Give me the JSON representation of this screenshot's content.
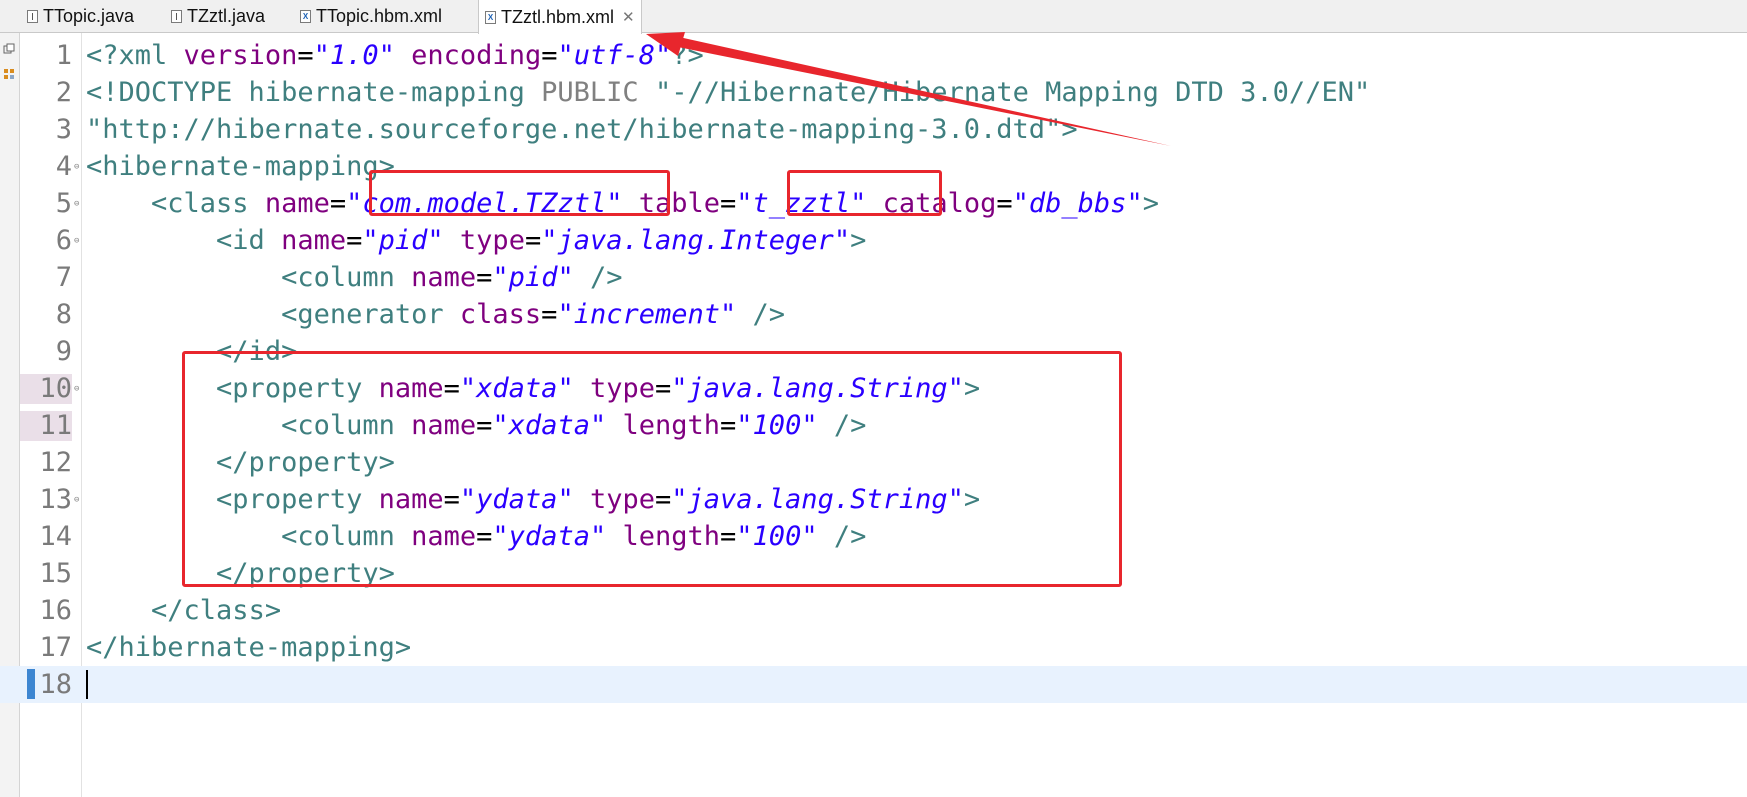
{
  "editor": {
    "tabs": [
      {
        "label": "TTopic.java",
        "icon": "java-file-icon",
        "active": false
      },
      {
        "label": "TZztl.java",
        "icon": "java-file-icon",
        "active": false
      },
      {
        "label": "TTopic.hbm.xml",
        "icon": "xml-file-icon",
        "active": false
      },
      {
        "label": "TZztl.hbm.xml",
        "icon": "xml-file-icon",
        "active": true,
        "close": "✕"
      }
    ],
    "xml_icon_glyph": "X",
    "selected_lines": [
      10,
      11
    ],
    "current_line": 18,
    "lines": [
      {
        "num": "1",
        "fold": false,
        "tokens": [
          [
            "tag",
            "<?xml "
          ],
          [
            "attr",
            "version"
          ],
          [
            "txt",
            "="
          ],
          [
            "str",
            "\"1.0\""
          ],
          [
            "txt",
            " "
          ],
          [
            "attr",
            "encoding"
          ],
          [
            "txt",
            "="
          ],
          [
            "str",
            "\"utf-8\""
          ],
          [
            "tag",
            "?>"
          ]
        ]
      },
      {
        "num": "2",
        "fold": false,
        "tokens": [
          [
            "tag",
            "<!DOCTYPE hibernate-mapping "
          ],
          [
            "kw",
            "PUBLIC"
          ],
          [
            "txt",
            " "
          ],
          [
            "doc",
            "\"-//Hibernate/Hibernate Mapping DTD 3.0//EN\""
          ]
        ]
      },
      {
        "num": "3",
        "fold": false,
        "tokens": [
          [
            "doc",
            "\"http://hibernate.sourceforge.net/hibernate-mapping-3.0.dtd\""
          ],
          [
            "tag",
            ">"
          ]
        ]
      },
      {
        "num": "4",
        "fold": true,
        "tokens": [
          [
            "tag",
            "<hibernate-mapping>"
          ]
        ]
      },
      {
        "num": "5",
        "fold": true,
        "tokens": [
          [
            "txt",
            "    "
          ],
          [
            "tag",
            "<class "
          ],
          [
            "attr",
            "name"
          ],
          [
            "txt",
            "="
          ],
          [
            "str",
            "\"com.model.TZztl\""
          ],
          [
            "txt",
            " "
          ],
          [
            "attr",
            "table"
          ],
          [
            "txt",
            "="
          ],
          [
            "str",
            "\"t_zztl\""
          ],
          [
            "txt",
            " "
          ],
          [
            "attr",
            "catalog"
          ],
          [
            "txt",
            "="
          ],
          [
            "str",
            "\"db_bbs\""
          ],
          [
            "tag",
            ">"
          ]
        ]
      },
      {
        "num": "6",
        "fold": true,
        "tokens": [
          [
            "txt",
            "        "
          ],
          [
            "tag",
            "<id "
          ],
          [
            "attr",
            "name"
          ],
          [
            "txt",
            "="
          ],
          [
            "str",
            "\"pid\""
          ],
          [
            "txt",
            " "
          ],
          [
            "attr",
            "type"
          ],
          [
            "txt",
            "="
          ],
          [
            "str",
            "\"java.lang.Integer\""
          ],
          [
            "tag",
            ">"
          ]
        ]
      },
      {
        "num": "7",
        "fold": false,
        "tokens": [
          [
            "txt",
            "            "
          ],
          [
            "tag",
            "<column "
          ],
          [
            "attr",
            "name"
          ],
          [
            "txt",
            "="
          ],
          [
            "str",
            "\"pid\""
          ],
          [
            "txt",
            " "
          ],
          [
            "tag",
            "/>"
          ]
        ]
      },
      {
        "num": "8",
        "fold": false,
        "tokens": [
          [
            "txt",
            "            "
          ],
          [
            "tag",
            "<generator "
          ],
          [
            "attr",
            "class"
          ],
          [
            "txt",
            "="
          ],
          [
            "str",
            "\"increment\""
          ],
          [
            "txt",
            " "
          ],
          [
            "tag",
            "/>"
          ]
        ]
      },
      {
        "num": "9",
        "fold": false,
        "tokens": [
          [
            "txt",
            "        "
          ],
          [
            "tag",
            "</id>"
          ]
        ]
      },
      {
        "num": "10",
        "fold": true,
        "tokens": [
          [
            "txt",
            "        "
          ],
          [
            "tag",
            "<property "
          ],
          [
            "attr",
            "name"
          ],
          [
            "txt",
            "="
          ],
          [
            "str",
            "\"xdata\""
          ],
          [
            "txt",
            " "
          ],
          [
            "attr",
            "type"
          ],
          [
            "txt",
            "="
          ],
          [
            "str",
            "\"java.lang.String\""
          ],
          [
            "tag",
            ">"
          ]
        ]
      },
      {
        "num": "11",
        "fold": false,
        "tokens": [
          [
            "txt",
            "            "
          ],
          [
            "tag",
            "<column "
          ],
          [
            "attr",
            "name"
          ],
          [
            "txt",
            "="
          ],
          [
            "str",
            "\"xdata\""
          ],
          [
            "txt",
            " "
          ],
          [
            "attr",
            "length"
          ],
          [
            "txt",
            "="
          ],
          [
            "str",
            "\"100\""
          ],
          [
            "txt",
            " "
          ],
          [
            "tag",
            "/>"
          ]
        ]
      },
      {
        "num": "12",
        "fold": false,
        "tokens": [
          [
            "txt",
            "        "
          ],
          [
            "tag",
            "</property>"
          ]
        ]
      },
      {
        "num": "13",
        "fold": true,
        "tokens": [
          [
            "txt",
            "        "
          ],
          [
            "tag",
            "<property "
          ],
          [
            "attr",
            "name"
          ],
          [
            "txt",
            "="
          ],
          [
            "str",
            "\"ydata\""
          ],
          [
            "txt",
            " "
          ],
          [
            "attr",
            "type"
          ],
          [
            "txt",
            "="
          ],
          [
            "str",
            "\"java.lang.String\""
          ],
          [
            "tag",
            ">"
          ]
        ]
      },
      {
        "num": "14",
        "fold": false,
        "tokens": [
          [
            "txt",
            "            "
          ],
          [
            "tag",
            "<column "
          ],
          [
            "attr",
            "name"
          ],
          [
            "txt",
            "="
          ],
          [
            "str",
            "\"ydata\""
          ],
          [
            "txt",
            " "
          ],
          [
            "attr",
            "length"
          ],
          [
            "txt",
            "="
          ],
          [
            "str",
            "\"100\""
          ],
          [
            "txt",
            " "
          ],
          [
            "tag",
            "/>"
          ]
        ]
      },
      {
        "num": "15",
        "fold": false,
        "tokens": [
          [
            "txt",
            "        "
          ],
          [
            "tag",
            "</property>"
          ]
        ]
      },
      {
        "num": "16",
        "fold": false,
        "tokens": [
          [
            "txt",
            "    "
          ],
          [
            "tag",
            "</class>"
          ]
        ]
      },
      {
        "num": "17",
        "fold": false,
        "tokens": [
          [
            "tag",
            "</hibernate-mapping>"
          ]
        ]
      },
      {
        "num": "18",
        "fold": false,
        "tokens": []
      }
    ]
  },
  "annotations": {
    "color": "#e8262d",
    "highlights": [
      "class-name-value",
      "table-name-value",
      "property-block"
    ],
    "arrow_target": "active-tab"
  }
}
